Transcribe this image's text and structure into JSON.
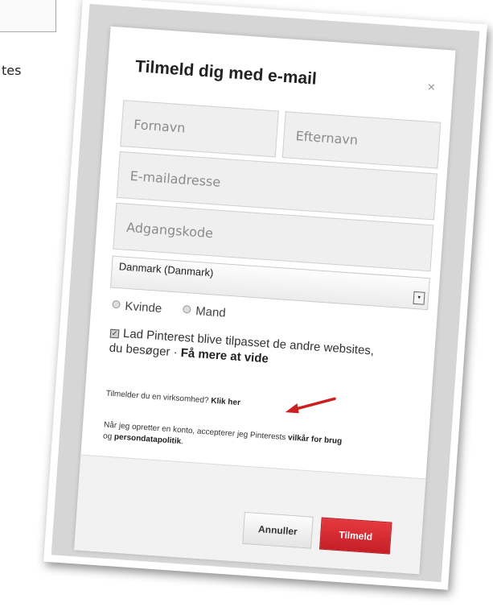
{
  "background": {
    "text_fragment": "tes"
  },
  "dialog": {
    "title": "Tilmeld dig med e-mail",
    "close_label": "×",
    "fields": {
      "first_name_placeholder": "Fornavn",
      "last_name_placeholder": "Efternavn",
      "email_placeholder": "E-mailadresse",
      "password_placeholder": "Adgangskode"
    },
    "country": {
      "selected": "Danmark (Danmark)",
      "arrow_glyph": "▾"
    },
    "gender": {
      "female": "Kvinde",
      "male": "Mand"
    },
    "personalize": {
      "checked_glyph": "✓",
      "text": "Lad Pinterest blive tilpasset de andre websites, du besøger ·",
      "learn_more": "Få mere at vide"
    },
    "business": {
      "question": "Tilmelder du en virksomhed?",
      "link": "Klik her"
    },
    "terms": {
      "prefix": "Når jeg opretter en konto, accepterer jeg Pinterests",
      "terms_link": "vilkår for brug",
      "joiner": "og",
      "privacy_link": "persondatapolitik",
      "suffix": "."
    },
    "buttons": {
      "cancel": "Annuller",
      "signup": "Tilmeld"
    }
  },
  "colors": {
    "primary_button": "#d5262c",
    "annotation_arrow": "#cc1f1f",
    "field_background": "#efefef",
    "photo_backdrop": "#d6d6d6"
  }
}
